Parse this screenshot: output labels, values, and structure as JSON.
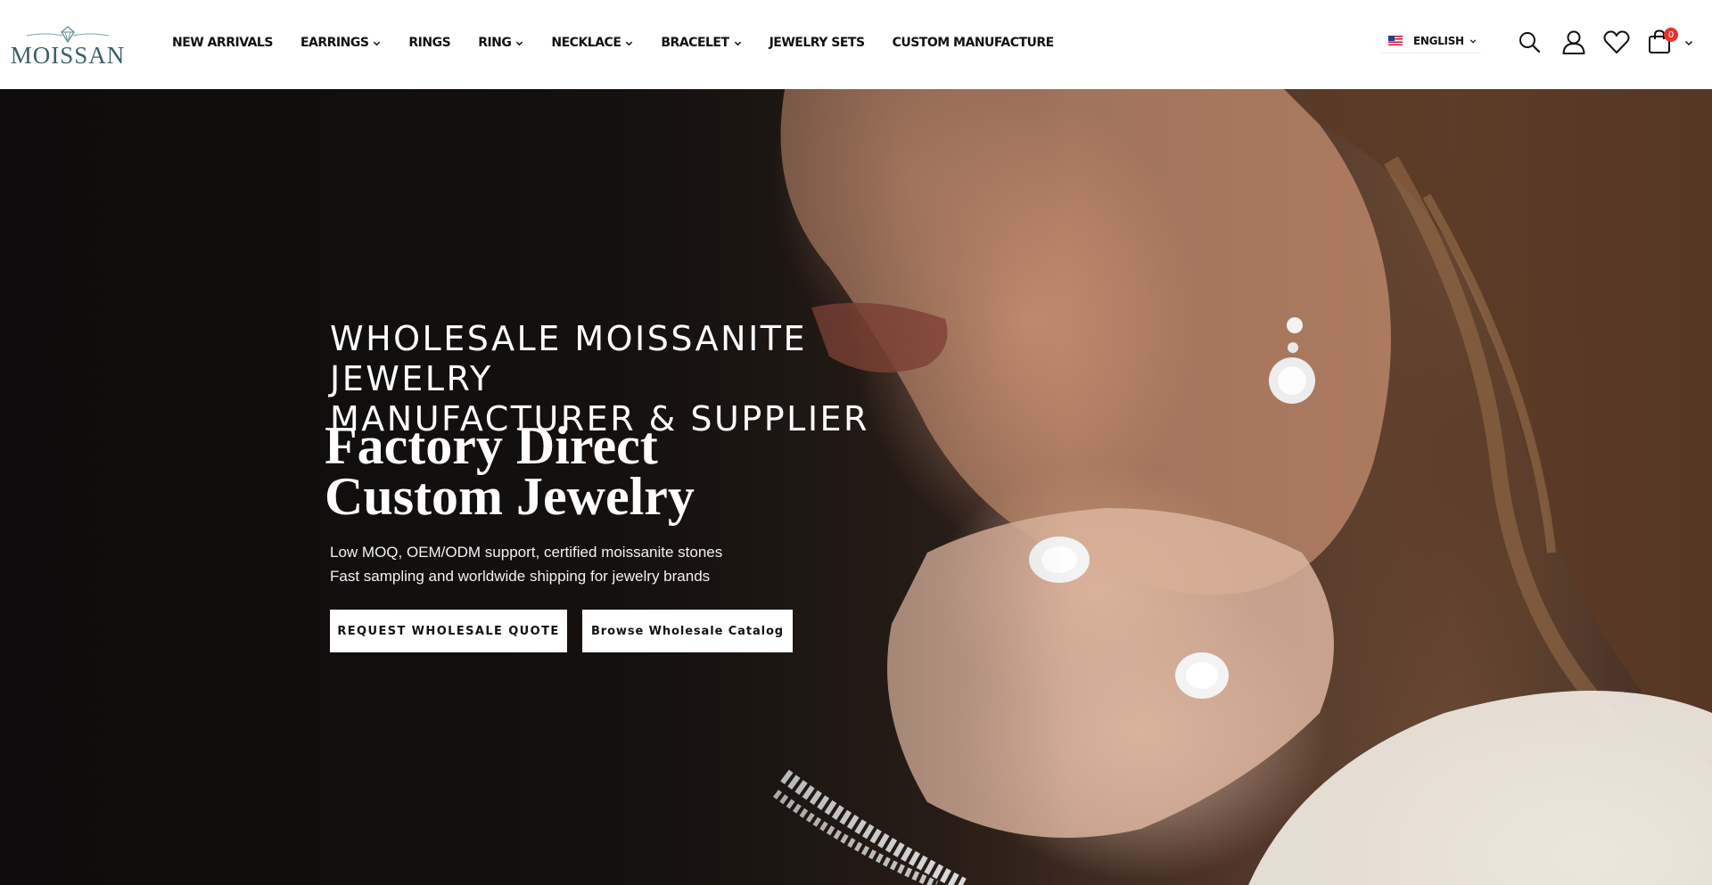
{
  "brand": {
    "logo_text": "MOISSAN"
  },
  "nav": {
    "items": [
      {
        "label": "NEW ARRIVALS",
        "has_dropdown": false
      },
      {
        "label": "EARRINGS",
        "has_dropdown": true
      },
      {
        "label": "RINGS",
        "has_dropdown": false
      },
      {
        "label": "RING",
        "has_dropdown": true
      },
      {
        "label": "NECKLACE",
        "has_dropdown": true
      },
      {
        "label": "BRACELET",
        "has_dropdown": true
      },
      {
        "label": "JEWELRY SETS",
        "has_dropdown": false
      },
      {
        "label": "CUSTOM MANUFACTURE",
        "has_dropdown": false
      }
    ]
  },
  "language": {
    "label": "ENGLISH",
    "flag": "us-flag-icon"
  },
  "header_icons": {
    "search": "search-icon",
    "account": "user-icon",
    "wishlist": "heart-icon",
    "cart": "bag-icon",
    "cart_count": "0"
  },
  "hero": {
    "kicker_line1": "WHOLESALE MOISSANITE JEWELRY",
    "kicker_line2": "MANUFACTURER & SUPPLIER",
    "title_line1": "Factory Direct",
    "title_line2": "Custom Jewelry",
    "sub_line1": "Low MOQ, OEM/ODM support, certified moissanite stones",
    "sub_line2": "Fast sampling and worldwide shipping for jewelry brands",
    "cta_primary": "REQUEST WHOLESALE QUOTE",
    "cta_secondary": "Browse Wholesale Catalog"
  },
  "colors": {
    "accent_badge": "#e5332a",
    "logo": "#3c5f68",
    "button_bg": "#ffffff",
    "hero_dark": "#151210"
  }
}
